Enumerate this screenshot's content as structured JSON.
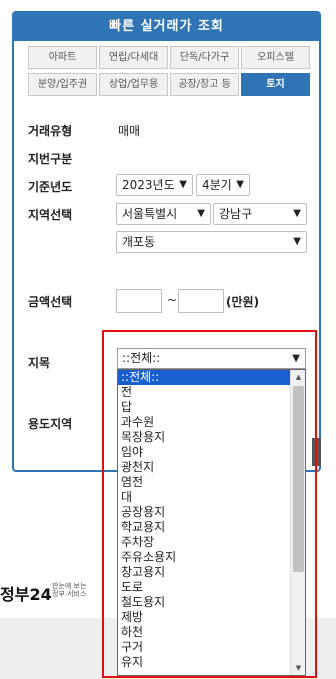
{
  "header": {
    "title": "빠른 실거래가 조회"
  },
  "tabs": {
    "row1": [
      "아파트",
      "연립/다세대",
      "단독/다가구",
      "오피스텔"
    ],
    "row2": [
      "분양/입주권",
      "상업/업무용",
      "공장/창고 등",
      "토지"
    ],
    "active": "토지"
  },
  "form": {
    "trade_type_label": "거래유형",
    "trade_type_value": "매매",
    "lot_type_label": "지번구분",
    "base_year_label": "기준년도",
    "year_value": "2023년도",
    "quarter_value": "4분기",
    "region_label": "지역선택",
    "city_value": "서울특별시",
    "district_value": "강남구",
    "dong_value": "개포동",
    "amount_label": "금액선택",
    "amount_sep": "~",
    "amount_unit": "(만원)",
    "land_cat_label": "지목",
    "land_cat_value": "::전체::",
    "zoning_label": "용도지역"
  },
  "dropdown": {
    "options": [
      "::전체::",
      "전",
      "답",
      "과수원",
      "목장용지",
      "임야",
      "광천지",
      "염전",
      "대",
      "공장용지",
      "학교용지",
      "주차장",
      "주유소용지",
      "창고용지",
      "도로",
      "철도용지",
      "제방",
      "하천",
      "구거",
      "유지"
    ],
    "selected_index": 0
  },
  "footer": {
    "gov_logo": "정부24",
    "gov_sub_line1": "한눈에 보는",
    "gov_sub_line2": "정부 서비스"
  }
}
